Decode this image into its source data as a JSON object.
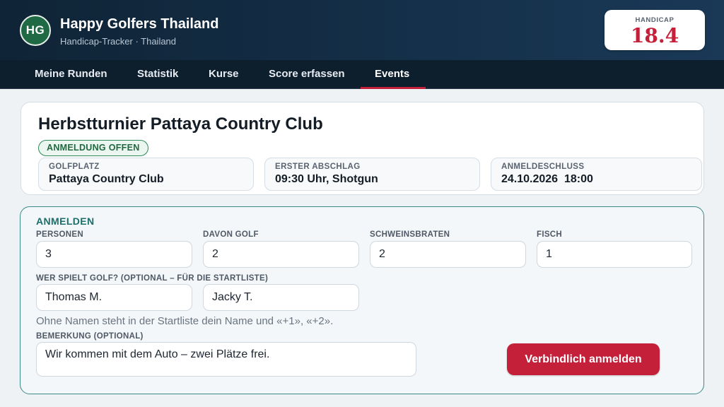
{
  "header": {
    "logo_initials": "HG",
    "title": "Happy Golfers Thailand",
    "subtitle": "Handicap-Tracker · Thailand",
    "handicap_label": "HANDICAP",
    "handicap_value": "18.4"
  },
  "nav": {
    "items": [
      {
        "label": "Meine Runden"
      },
      {
        "label": "Statistik"
      },
      {
        "label": "Kurse"
      },
      {
        "label": "Score erfassen"
      },
      {
        "label": "Events",
        "active": true
      }
    ]
  },
  "event": {
    "title": "Herbstturnier Pattaya Country Club",
    "status": "ANMELDUNG OFFEN",
    "info": [
      {
        "label": "GOLFPLATZ",
        "value": "Pattaya Country Club"
      },
      {
        "label": "ERSTER ABSCHLAG",
        "value": "09:30 Uhr, Shotgun"
      },
      {
        "label": "ANMELDESCHLUSS",
        "value": "24.10.2026  18:00"
      }
    ]
  },
  "form": {
    "title": "ANMELDEN",
    "fields": [
      {
        "label": "PERSONEN",
        "value": "3"
      },
      {
        "label": "DAVON GOLF",
        "value": "2"
      },
      {
        "label": "SCHWEINSBRATEN",
        "value": "2"
      },
      {
        "label": "FISCH",
        "value": "1"
      }
    ],
    "players_label": "WER SPIELT GOLF? (OPTIONAL – FÜR DIE STARTLISTE)",
    "players": [
      "Thomas M.",
      "Jacky T."
    ],
    "hint": "Ohne Namen steht in der Startliste dein Name und «+1», «+2».",
    "remark_label": "BEMERKUNG (OPTIONAL)",
    "remark_value": "Wir kommen mit dem Auto – zwei Plätze frei.",
    "submit_label": "Verbindlich anmelden"
  },
  "colors": {
    "accent": "#c4203a",
    "header_bg": "#15304a",
    "form_border": "#3b8a86",
    "status_green": "#2e8a58"
  }
}
